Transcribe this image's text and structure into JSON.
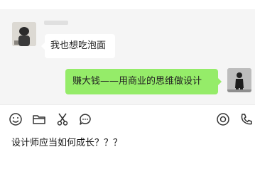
{
  "chat": {
    "messages": [
      {
        "side": "incoming",
        "text": "我也想吃泡面"
      },
      {
        "side": "outgoing",
        "text": "赚大钱——用商业的思维做设计"
      }
    ]
  },
  "toolbar": {
    "icons": [
      "emoji-icon",
      "folder-icon",
      "scissors-icon",
      "chat-bubble-icon",
      "record-icon",
      "phone-icon"
    ]
  },
  "compose": {
    "draft": "设计师应当如何成长？？？"
  },
  "colors": {
    "outgoing_bubble": "#95ec69",
    "incoming_bubble": "#ffffff",
    "chat_background": "#f5f5f5"
  }
}
